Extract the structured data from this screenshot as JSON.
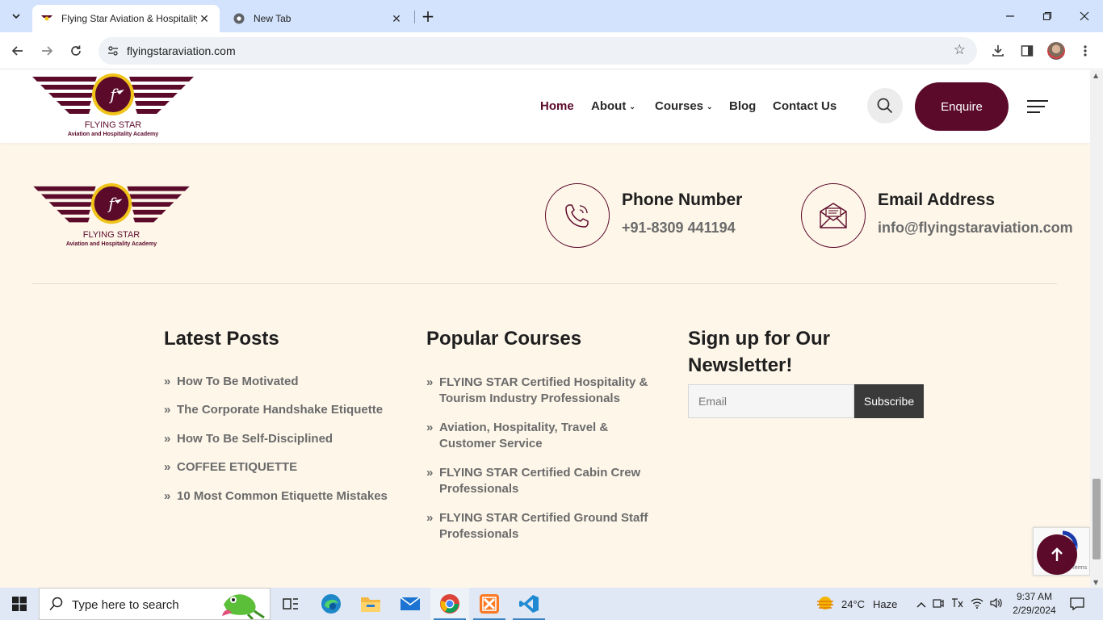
{
  "browser": {
    "tabs": [
      {
        "title": "Flying Star Aviation & Hospitality",
        "active": true
      },
      {
        "title": "New Tab",
        "active": false
      }
    ],
    "url": "flyingstaraviation.com"
  },
  "header": {
    "brand_name": "FLYING STAR",
    "brand_tagline": "Aviation and Hospitality Academy",
    "nav": [
      {
        "label": "Home",
        "active": true,
        "dropdown": false
      },
      {
        "label": "About",
        "active": false,
        "dropdown": true
      },
      {
        "label": "Courses",
        "active": false,
        "dropdown": true
      },
      {
        "label": "Blog",
        "active": false,
        "dropdown": false
      },
      {
        "label": "Contact Us",
        "active": false,
        "dropdown": false
      }
    ],
    "enquire_label": "Enquire"
  },
  "footer": {
    "brand_name": "FLYING STAR",
    "brand_tagline": "Aviation and Hospitality Academy",
    "phone": {
      "title": "Phone Number",
      "value": "+91-8309 441194"
    },
    "email": {
      "title": "Email Address",
      "value": "info@flyingstaraviation.com"
    },
    "latest_posts": {
      "title": "Latest Posts",
      "items": [
        "How To Be Motivated",
        "The Corporate Handshake Etiquette",
        "How To Be Self-Disciplined",
        "COFFEE ETIQUETTE",
        "10 Most Common Etiquette Mistakes"
      ]
    },
    "popular_courses": {
      "title": "Popular Courses",
      "items": [
        [
          "FLYING STAR Certified Hospitality &",
          "Tourism Industry Professionals"
        ],
        [
          "Aviation, Hospitality, Travel &",
          "Customer Service"
        ],
        [
          "FLYING STAR Certified Cabin Crew",
          "Professionals"
        ],
        [
          "FLYING STAR Certified Ground Staff",
          "Professionals"
        ]
      ]
    },
    "newsletter": {
      "title_line1": "Sign up for Our",
      "title_line2": "Newsletter!",
      "email_placeholder": "Email",
      "subscribe_label": "Subscribe"
    },
    "recaptcha_text": "Privacy - Terms"
  },
  "taskbar": {
    "search_placeholder": "Type here to search",
    "weather": {
      "temp": "24°C",
      "condition": "Haze"
    },
    "time": "9:37 AM",
    "date": "2/29/2024"
  },
  "colors": {
    "brand": "#5c0a2a",
    "footer_bg": "#fdf6e9",
    "accent_yellow": "#f0c419"
  }
}
